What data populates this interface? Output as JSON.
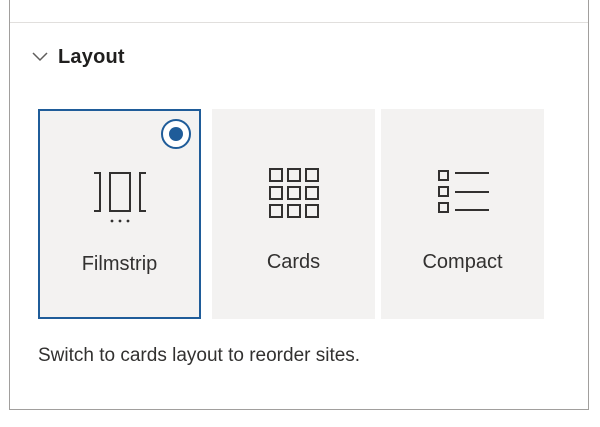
{
  "section": {
    "title": "Layout",
    "chevron_icon": "chevron-down-icon"
  },
  "layout_options": [
    {
      "label": "Filmstrip",
      "icon": "filmstrip-icon",
      "selected": true
    },
    {
      "label": "Cards",
      "icon": "cards-grid-icon",
      "selected": false
    },
    {
      "label": "Compact",
      "icon": "compact-list-icon",
      "selected": false
    }
  ],
  "hint_text": "Switch to cards layout to reorder sites.",
  "colors": {
    "accent": "#1f5c99",
    "tile_background": "#f3f2f1",
    "border": "#a19f9d",
    "text": "#323130"
  }
}
